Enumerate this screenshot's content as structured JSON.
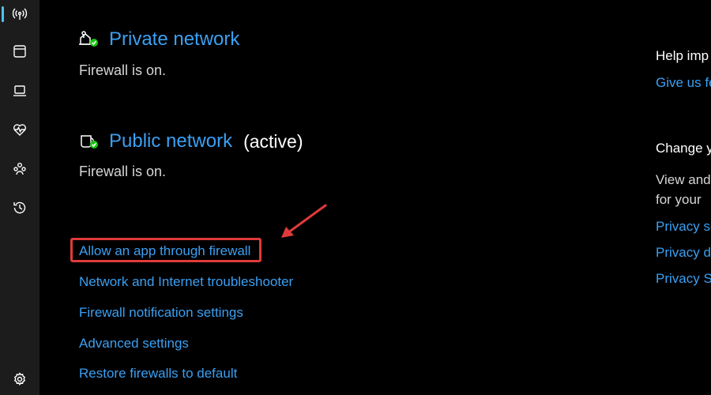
{
  "sidebar": {
    "items": [
      {
        "icon": "antenna-icon",
        "selected": true
      },
      {
        "icon": "app-browser-icon"
      },
      {
        "icon": "laptop-icon"
      },
      {
        "icon": "health-heart-icon"
      },
      {
        "icon": "family-icon"
      },
      {
        "icon": "history-icon"
      }
    ],
    "settings_icon": "gear-icon"
  },
  "private_network": {
    "title": "Private network",
    "status": "Firewall is on."
  },
  "public_network": {
    "title": "Public network",
    "active_label": "(active)",
    "status": "Firewall is on."
  },
  "links": {
    "allow_app": "Allow an app through firewall",
    "troubleshooter": "Network and Internet troubleshooter",
    "notification_settings": "Firewall notification settings",
    "advanced_settings": "Advanced settings",
    "restore_defaults": "Restore firewalls to default"
  },
  "right_column": {
    "help_heading": "Help imp",
    "feedback_link": "Give us fe",
    "change_heading": "Change y",
    "view_text_1": "View and",
    "view_text_2": "for your",
    "privacy_link_1": "Privacy se",
    "privacy_link_2": "Privacy d",
    "privacy_link_3": "Privacy St"
  },
  "colors": {
    "accent": "#3aa0f3",
    "highlight": "#e03a3a",
    "status_ok": "#16c60c"
  }
}
